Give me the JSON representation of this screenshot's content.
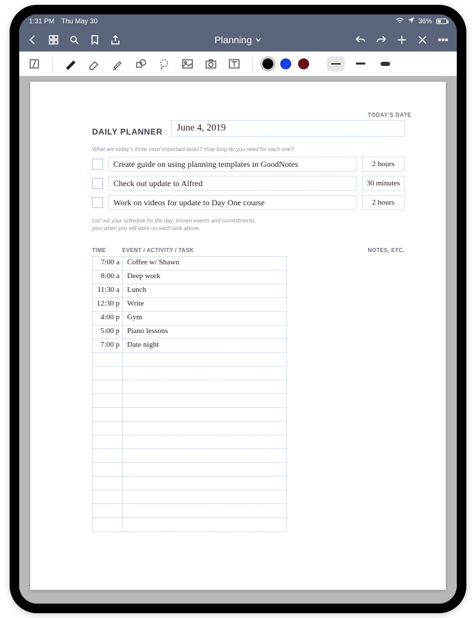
{
  "status": {
    "time": "1:31 PM",
    "date": "Thu May 30",
    "battery_pct": "36%"
  },
  "nav": {
    "title": "Planning"
  },
  "toolbar": {
    "colors": [
      "#000000",
      "#1a3fe0",
      "#6b1018"
    ],
    "active_color_index": 0,
    "active_stroke": "thin"
  },
  "planner": {
    "todays_date_label": "TODAY'S DATE",
    "title": "DAILY PLANNER",
    "date_value": "June 4, 2019",
    "tasks_prompt": "What are today's three most important tasks? How long do you need for each one?",
    "tasks": [
      {
        "text": "Create guide on using planning templates in GoodNotes",
        "duration": "2 hours"
      },
      {
        "text": "Check out update to Alfred",
        "duration": "30 minutes"
      },
      {
        "text": "Work on videos for update to Day One course",
        "duration": "2 hours"
      }
    ],
    "schedule_prompt_line1": "List out your schedule for the day: known events and commitments,",
    "schedule_prompt_line2": "plus when you will work on each task above.",
    "col_time": "TIME",
    "col_event": "EVENT / ACTIVITY / TASK",
    "notes_label": "NOTES, ETC.",
    "schedule": [
      {
        "time": "7:00 a",
        "event": "Coffee w/ Shawn"
      },
      {
        "time": "8:00 a",
        "event": "Deep work"
      },
      {
        "time": "11:30 a",
        "event": "Lunch"
      },
      {
        "time": "12:30 p",
        "event": "Write"
      },
      {
        "time": "4:00 p",
        "event": "Gym"
      },
      {
        "time": "5:00 p",
        "event": "Piano lessons"
      },
      {
        "time": "7:00 p",
        "event": "Date night"
      },
      {
        "time": "",
        "event": ""
      },
      {
        "time": "",
        "event": ""
      },
      {
        "time": "",
        "event": ""
      },
      {
        "time": "",
        "event": ""
      },
      {
        "time": "",
        "event": ""
      },
      {
        "time": "",
        "event": ""
      },
      {
        "time": "",
        "event": ""
      },
      {
        "time": "",
        "event": ""
      },
      {
        "time": "",
        "event": ""
      },
      {
        "time": "",
        "event": ""
      },
      {
        "time": "",
        "event": ""
      },
      {
        "time": "",
        "event": ""
      },
      {
        "time": "",
        "event": ""
      }
    ]
  }
}
